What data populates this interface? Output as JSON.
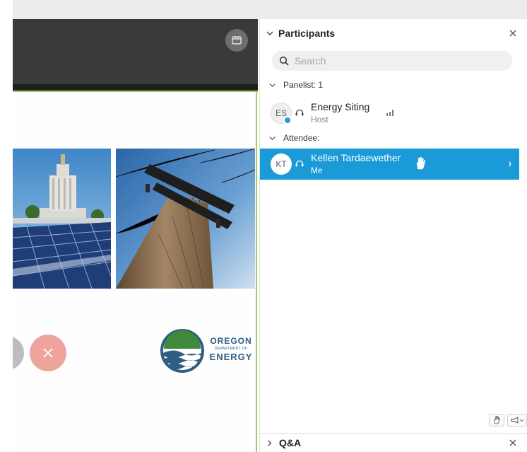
{
  "participants_panel": {
    "title": "Participants",
    "search_placeholder": "Search",
    "panelist_group_label": "Panelist: 1",
    "attendee_group_label": "Attendee:",
    "panelists": [
      {
        "initials": "ES",
        "name": "Energy Siting",
        "role": "Host"
      }
    ],
    "attendees": [
      {
        "initials": "KT",
        "name": "Kellen Tardaewether",
        "role": "Me"
      }
    ]
  },
  "qa_panel": {
    "title": "Q&A"
  },
  "slide": {
    "logo": {
      "line1": "OREGON",
      "line2": "DEPARTMENT OF",
      "line3": "ENERGY"
    }
  },
  "colors": {
    "selected_row": "#1b9ad8",
    "stage_header": "#3a3a3a",
    "accent_green": "#9dcc6a",
    "end_call": "#eea49c",
    "logo_blue": "#2f5d84",
    "logo_green": "#3f8a3a"
  },
  "icons": {
    "layout": "layout-icon",
    "collapse": "chevron-down-icon",
    "expand": "chevron-right-icon",
    "close": "close-icon",
    "search": "search-icon",
    "headset": "headset-icon",
    "signal": "signal-bars-icon",
    "raised_hand": "raised-hand-icon",
    "volume": "volume-icon",
    "end_call": "end-call-icon"
  }
}
